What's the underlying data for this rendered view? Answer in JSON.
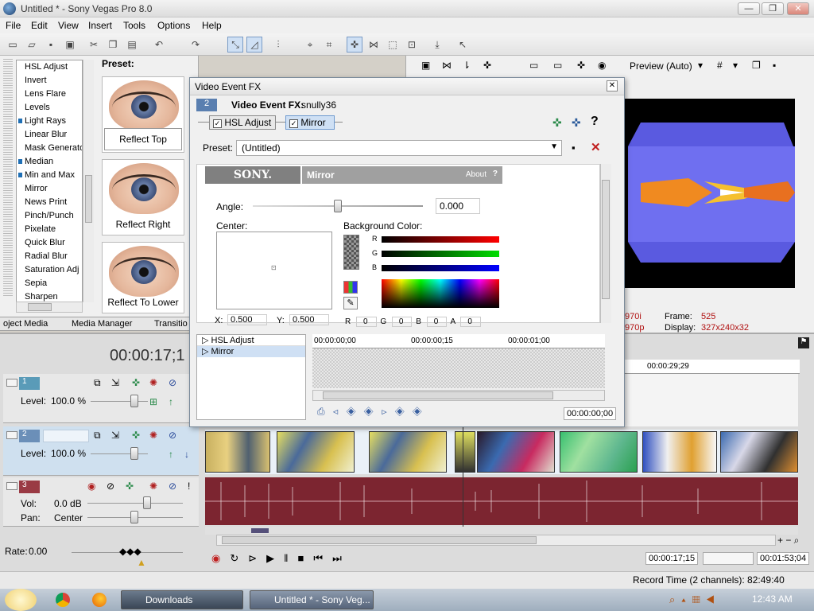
{
  "window": {
    "title": "Untitled * - Sony Vegas Pro 8.0",
    "min": "—",
    "max": "❐",
    "close": "✕"
  },
  "menu": [
    "File",
    "Edit",
    "View",
    "Insert",
    "Tools",
    "Options",
    "Help"
  ],
  "fx_list": {
    "header": "Preset:",
    "items": [
      {
        "label": "HSL Adjust",
        "dot": false
      },
      {
        "label": "Invert",
        "dot": false
      },
      {
        "label": "Lens Flare",
        "dot": false
      },
      {
        "label": "Levels",
        "dot": false
      },
      {
        "label": "Light Rays",
        "dot": true
      },
      {
        "label": "Linear Blur",
        "dot": false
      },
      {
        "label": "Mask Generato",
        "dot": false
      },
      {
        "label": "Median",
        "dot": true
      },
      {
        "label": "Min and Max",
        "dot": true
      },
      {
        "label": "Mirror",
        "dot": false
      },
      {
        "label": "News Print",
        "dot": false
      },
      {
        "label": "Pinch/Punch",
        "dot": false
      },
      {
        "label": "Pixelate",
        "dot": false
      },
      {
        "label": "Quick Blur",
        "dot": false
      },
      {
        "label": "Radial Blur",
        "dot": false
      },
      {
        "label": "Saturation Adj",
        "dot": false
      },
      {
        "label": "Sepia",
        "dot": false
      },
      {
        "label": "Sharpen",
        "dot": false
      }
    ],
    "presets": [
      "Reflect Top",
      "Reflect Right",
      "Reflect To Lower"
    ]
  },
  "tabs": [
    "oject Media",
    "Media Manager",
    "Transitio"
  ],
  "preview": {
    "mode": "Preview (Auto)",
    "frame_label": "Frame:",
    "frame_value": "525",
    "display_label": "Display:",
    "display_value": "327x240x32",
    "res1": "970i",
    "res2": "970p"
  },
  "dialog": {
    "title": "Video Event FX",
    "badge": "2",
    "event_label": "Video Event FX:",
    "event_name": "snully36",
    "chain": [
      "HSL Adjust",
      "Mirror"
    ],
    "preset_label": "Preset:",
    "preset_value": "(Untitled)",
    "brand": "SONY.",
    "plugin_name": "Mirror",
    "about": "About",
    "help": "?",
    "angle_label": "Angle:",
    "angle_value": "0.000",
    "angle_fraction": 0.5,
    "center_label": "Center:",
    "bg_label": "Background Color:",
    "rgb": [
      "R",
      "G",
      "B"
    ],
    "xy_labels": [
      "X:",
      "Y:"
    ],
    "xy_values": [
      "0.500",
      "0.500"
    ],
    "rgba_labels": [
      "R",
      "G",
      "B",
      "A"
    ],
    "rgba_values": [
      "0",
      "0",
      "0",
      "0"
    ],
    "kf_tracks": [
      "HSL Adjust",
      "Mirror"
    ],
    "kf_ruler": [
      "00:00:00;00",
      "00:00:00;15",
      "00:00:01;00"
    ],
    "kf_time": "00:00:00;00"
  },
  "timeline": {
    "timecode": "00:00:17;1",
    "ruler_mark": "00:00:29;29",
    "tracks": [
      {
        "num": "1",
        "type": "video",
        "level_label": "Level:",
        "level": "100.0 %"
      },
      {
        "num": "2",
        "type": "video",
        "level_label": "Level:",
        "level": "100.0 %"
      },
      {
        "num": "3",
        "type": "audio",
        "vol_label": "Vol:",
        "vol": "0.0 dB",
        "pan_label": "Pan:",
        "pan": "Center"
      }
    ],
    "rate_label": "Rate:",
    "rate_value": "0.00",
    "cursor_time": "00:00:17;15",
    "end_time": "00:01:53;04",
    "record_time": "Record Time (2 channels): 82:49:40"
  },
  "taskbar": {
    "items": [
      "Downloads",
      "Untitled * - Sony Veg..."
    ],
    "clock": "12:43 AM"
  },
  "colors": {
    "audio": "#7c2530",
    "accent": "#2f6fb8",
    "preview_bg": "#5a62d8"
  }
}
